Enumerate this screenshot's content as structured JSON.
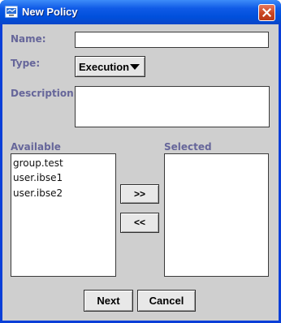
{
  "window": {
    "title": "New Policy",
    "title_bar_color": "#0050dc",
    "close_icon": "close-icon",
    "app_icon": "network-window-icon"
  },
  "form": {
    "name": {
      "label": "Name:",
      "value": ""
    },
    "type": {
      "label": "Type:",
      "selected": "Execution"
    },
    "description": {
      "label": "Description:",
      "value": ""
    }
  },
  "available": {
    "label": "Available",
    "items": [
      "group.test",
      "user.ibse1",
      "user.ibse2"
    ]
  },
  "selected": {
    "label": "Selected",
    "items": []
  },
  "buttons": {
    "add": ">>",
    "remove": "<<",
    "next": "Next",
    "cancel": "Cancel"
  },
  "colors": {
    "label_text": "#66669a",
    "dialog_background": "#cfcfcf"
  }
}
